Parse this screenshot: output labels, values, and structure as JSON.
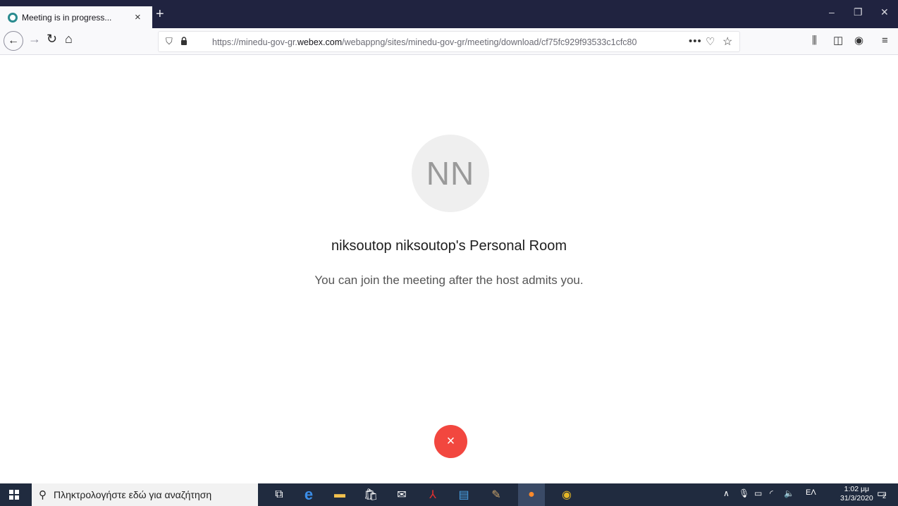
{
  "browser": {
    "tab_title": "Meeting is in progress...",
    "tab_close": "×",
    "new_tab": "+",
    "window_controls": {
      "minimize": "–",
      "restore": "❐",
      "close": "✕"
    },
    "url_prefix": "https://minedu-gov-gr.",
    "url_domain": "webex.com",
    "url_suffix": "/webappng/sites/minedu-gov-gr/meeting/download/cf75fc929f93533c1cfc80",
    "url_more": "•••"
  },
  "meeting": {
    "avatar_initials": "NN",
    "room_name": "niksoutop niksoutop's Personal Room",
    "wait_message": "You can join the meeting after the host admits you.",
    "leave_symbol": "×",
    "leave_color": "#f2473f"
  },
  "taskbar": {
    "search_placeholder": "Πληκτρολογήστε εδώ για αναζήτηση",
    "language": "ΕΛ",
    "time": "1:02 μμ",
    "date": "31/3/2020",
    "notification_count": "2"
  }
}
